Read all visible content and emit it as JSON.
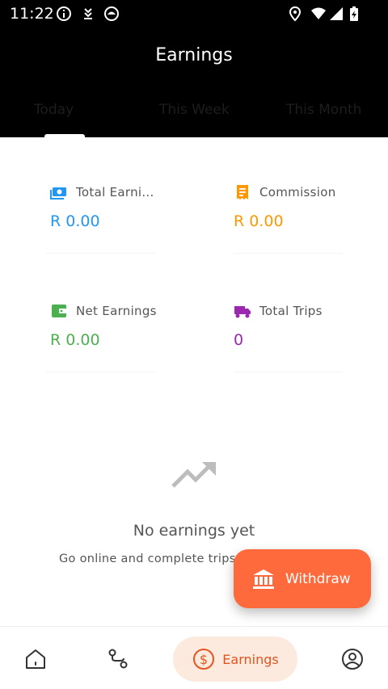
{
  "status_bar": {
    "time": "11:22",
    "left_icons": [
      "info-icon",
      "download-icon",
      "android-icon"
    ],
    "right_icons": [
      "location-icon",
      "wifi-icon",
      "signal-icon",
      "battery-charging-icon"
    ]
  },
  "header": {
    "title": "Earnings",
    "tabs": [
      {
        "label": "Today",
        "active": true
      },
      {
        "label": "This Week",
        "active": false
      },
      {
        "label": "This Month",
        "active": false
      }
    ]
  },
  "stats": {
    "total_earnings": {
      "label": "Total Earni...",
      "value": "R 0.00",
      "color": "#2196f3",
      "icon": "cash-icon"
    },
    "commission": {
      "label": "Commission",
      "value": "R 0.00",
      "color": "#ff9800",
      "icon": "receipt-icon"
    },
    "net_earnings": {
      "label": "Net Earnings",
      "value": "R 0.00",
      "color": "#4caf50",
      "icon": "wallet-icon"
    },
    "total_trips": {
      "label": "Total Trips",
      "value": "0",
      "color": "#9c27b0",
      "icon": "truck-icon"
    }
  },
  "empty_state": {
    "icon": "trending-up-icon",
    "title": "No earnings yet",
    "subtitle": "Go online and complete trips"
  },
  "withdraw": {
    "label": "Withdraw",
    "icon": "bank-icon",
    "color": "#ff6a3d"
  },
  "bottom_nav": {
    "items": [
      {
        "icon": "home-icon",
        "label": "Home",
        "active": false
      },
      {
        "icon": "route-icon",
        "label": "Trips",
        "active": false
      },
      {
        "icon": "dollar-circle-icon",
        "label": "Earnings",
        "active": true
      },
      {
        "icon": "profile-icon",
        "label": "Profile",
        "active": false
      }
    ],
    "active_color": "#e3541f"
  }
}
